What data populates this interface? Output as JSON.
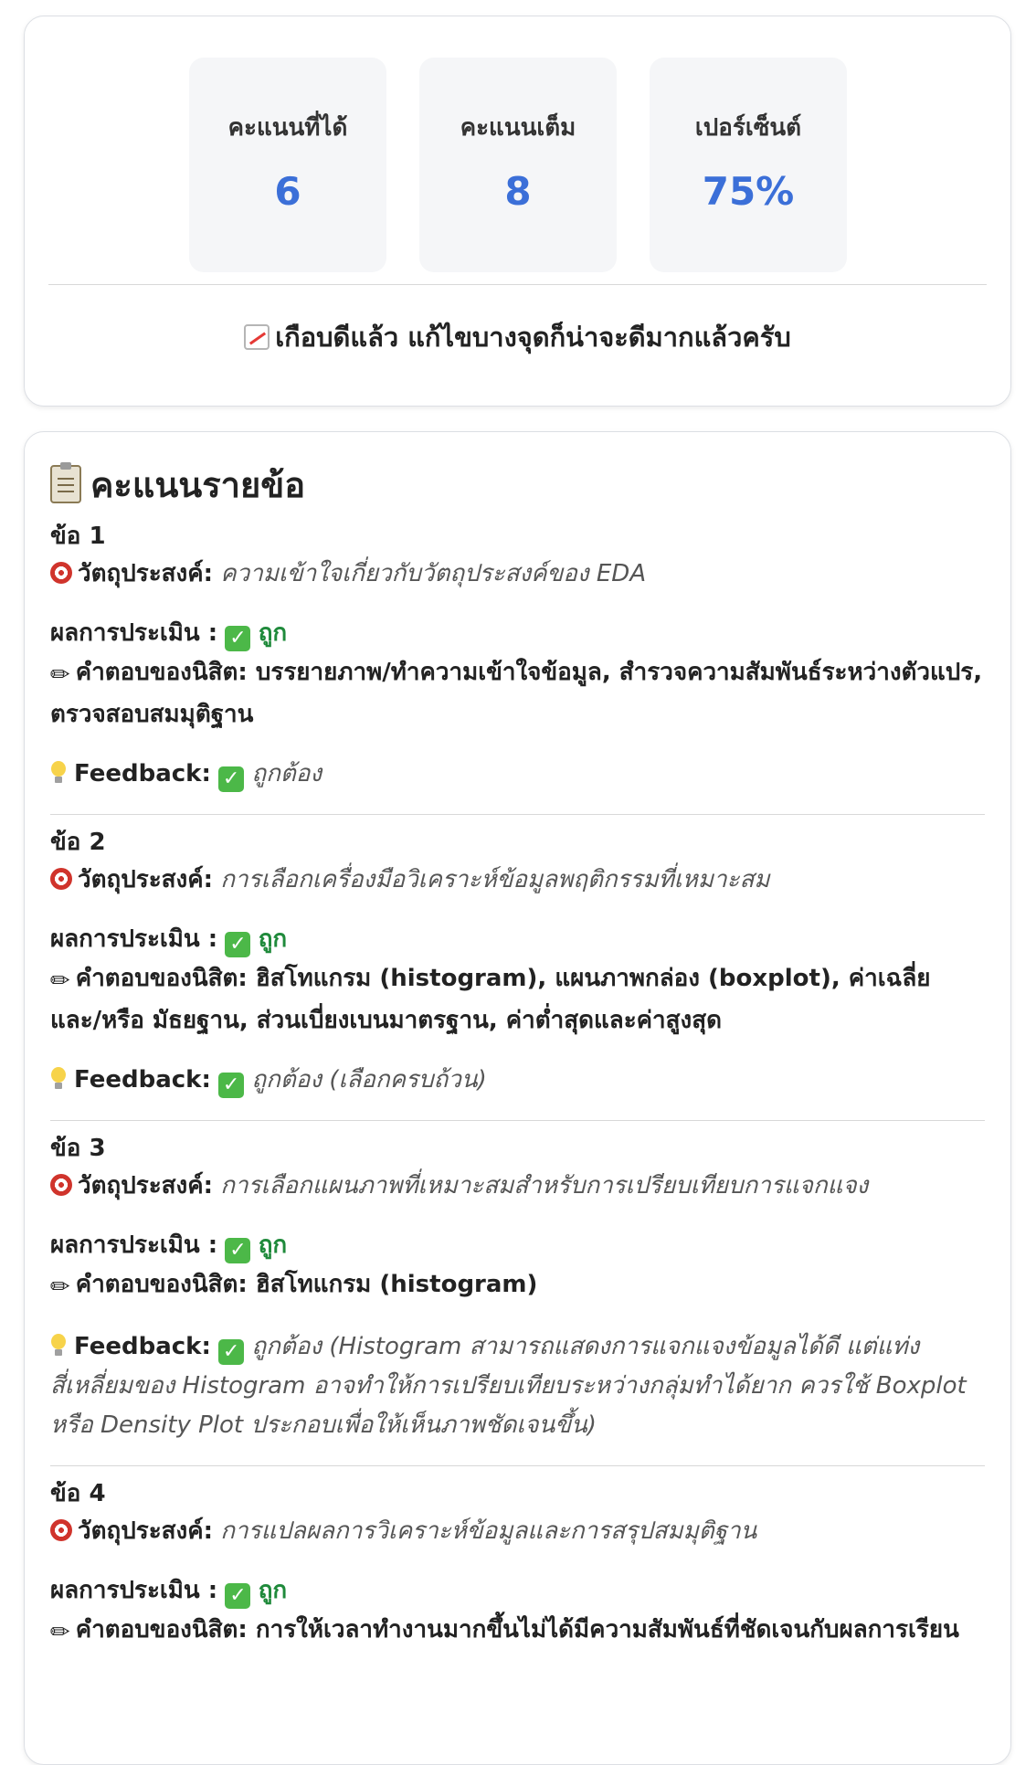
{
  "summary": {
    "stats": [
      {
        "label": "คะแนนที่ได้",
        "value": "6"
      },
      {
        "label": "คะแนนเต็ม",
        "value": "8"
      },
      {
        "label": "เปอร์เซ็นต์",
        "value": "75%"
      }
    ],
    "message": "เกือบดีแล้ว แก้ไขบางจุดก็น่าจะดีมากแล้วครับ"
  },
  "details": {
    "title": "คะแนนรายข้อ",
    "objective_label": "วัตถุประสงค์:",
    "result_label": "ผลการประเมิน :",
    "answer_label": "คำตอบของนิสิต:",
    "feedback_label": "Feedback:",
    "items": [
      {
        "no": "ข้อ 1",
        "objective": "ความเข้าใจเกี่ยวกับวัตถุประสงค์ของ EDA",
        "result": "ถูก",
        "answer": "บรรยายภาพ/ทำความเข้าใจข้อมูล, สำรวจความสัมพันธ์ระหว่างตัวแปร, ตรวจสอบสมมุติฐาน",
        "feedback": "ถูกต้อง"
      },
      {
        "no": "ข้อ 2",
        "objective": "การเลือกเครื่องมือวิเคราะห์ข้อมูลพฤติกรรมที่เหมาะสม",
        "result": "ถูก",
        "answer": "ฮิสโทแกรม (histogram), แผนภาพกล่อง (boxplot), ค่าเฉลี่ย และ/หรือ มัธยฐาน, ส่วนเบี่ยงเบนมาตรฐาน, ค่าต่ำสุดและค่าสูงสุด",
        "feedback": "ถูกต้อง (เลือกครบถ้วน)"
      },
      {
        "no": "ข้อ 3",
        "objective": "การเลือกแผนภาพที่เหมาะสมสำหรับการเปรียบเทียบการแจกแจง",
        "result": "ถูก",
        "answer": "ฮิสโทแกรม (histogram)",
        "feedback": "ถูกต้อง (Histogram สามารถแสดงการแจกแจงข้อมูลได้ดี แต่แท่งสี่เหลี่ยมของ Histogram อาจทำให้การเปรียบเทียบระหว่างกลุ่มทำได้ยาก ควรใช้ Boxplot หรือ Density Plot ประกอบเพื่อให้เห็นภาพชัดเจนขึ้น)"
      },
      {
        "no": "ข้อ 4",
        "objective": "การแปลผลการวิเคราะห์ข้อมูลและการสรุปสมมุติฐาน",
        "result": "ถูก",
        "answer": "การให้เวลาทำงานมากขึ้นไม่ได้มีความสัมพันธ์ที่ชัดเจนกับผลการเรียน"
      }
    ]
  }
}
